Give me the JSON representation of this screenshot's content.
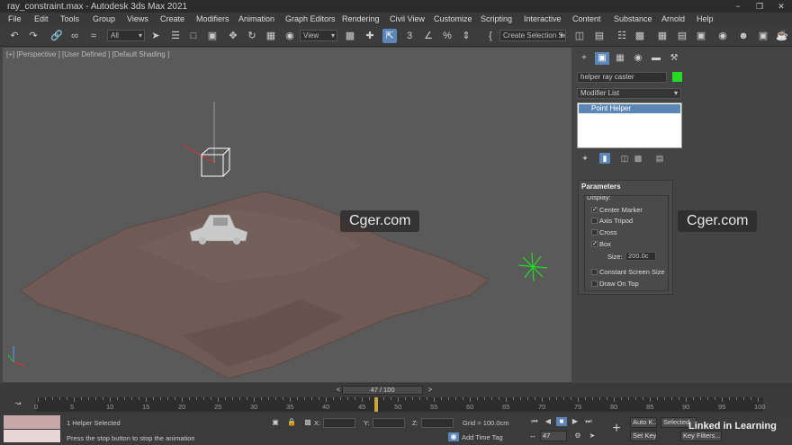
{
  "window": {
    "title": "ray_constraint.max - Autodesk 3ds Max 2021",
    "min": "−",
    "max": "❐",
    "close": "✕"
  },
  "menu": [
    "File",
    "Edit",
    "Tools",
    "Group",
    "Views",
    "Create",
    "Modifiers",
    "Animation",
    "Graph Editors",
    "Rendering",
    "Civil View",
    "Customize",
    "Scripting",
    "Interactive",
    "Content",
    "Substance",
    "Arnold",
    "Help"
  ],
  "toolbar": {
    "selection_filter": "All",
    "ref_coord": "View",
    "named_selection": "Create Selection Se"
  },
  "viewport": {
    "label": "[+] [Perspective ] [User Defined ] [Default Shading ]",
    "watermark": "Cger.com"
  },
  "command_panel": {
    "object_name": "helper ray caster",
    "object_color": "#22dd22",
    "modifier_list": "Modifier List",
    "stack_item": "Point Helper",
    "parameters": {
      "header": "Parameters",
      "display_label": "Display:",
      "center_marker": "Center Marker",
      "axis_tripod": "Axis Tripod",
      "cross": "Cross",
      "box": "Box",
      "size_label": "Size:",
      "size_value": "200.0c",
      "constant_screen_size": "Constant Screen Size",
      "draw_on_top": "Draw On Top"
    },
    "watermark": "Cger.com"
  },
  "timeline": {
    "slider_text": "47 / 100",
    "current_frame": 47,
    "ticks": [
      0,
      5,
      10,
      15,
      20,
      25,
      30,
      35,
      40,
      45,
      50,
      55,
      60,
      65,
      70,
      75,
      80,
      85,
      90,
      95,
      100
    ]
  },
  "status": {
    "selected": "1 Helper Selected",
    "prompt": "Press the stop button to stop the animation",
    "x_label": "X:",
    "y_label": "Y:",
    "z_label": "Z:",
    "grid": "Grid = 100.0cm",
    "add_time_tag": "Add Time Tag",
    "auto_key": "Auto K...",
    "set_key": "Set Key",
    "selected_dd": "Selected",
    "key_filters": "Key Filters...",
    "frame": "47",
    "brand": "Linked in Learning"
  },
  "colors": {
    "accent": "#5b86b8",
    "terrain": "#6f5a55",
    "helper_green": "#22dd22"
  }
}
